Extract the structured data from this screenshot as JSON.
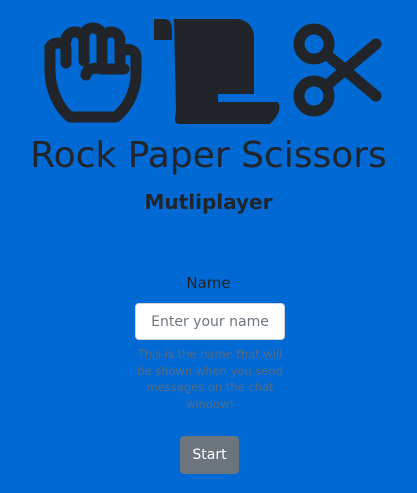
{
  "hero": {
    "icons": [
      "fist-icon",
      "scroll-icon",
      "scissors-icon"
    ],
    "icon_color": "#212529"
  },
  "header": {
    "title": "Rock Paper Scissors",
    "subtitle": "Mutliplayer"
  },
  "form": {
    "name_label": "Name",
    "name_placeholder": "Enter your name",
    "name_value": "",
    "help_text": "This is the name that will be shown when you send messages on the chat window!",
    "start_label": "Start"
  },
  "colors": {
    "background": "#0069d4",
    "text": "#212529",
    "help_text": "#5a6b80",
    "button": "#6c757d",
    "button_text": "#ffffff"
  }
}
